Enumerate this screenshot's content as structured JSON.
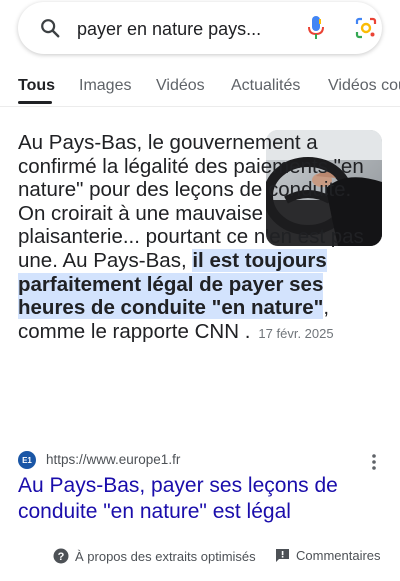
{
  "search": {
    "query": "payer en nature pays..."
  },
  "tabs": [
    {
      "label": "Tous",
      "active": true
    },
    {
      "label": "Images"
    },
    {
      "label": "Vidéos"
    },
    {
      "label": "Actualités"
    },
    {
      "label": "Vidéos cou"
    }
  ],
  "snippet": {
    "text_before": "Au Pays-Bas, le gouvernement a confirmé la légalité des paiements \"en nature\" pour des leçons de conduite. On croirait à une mauvaise plaisanterie... pourtant ce n'en est pas une. Au Pays-Bas, ",
    "highlight": "il est toujours parfaitement légal de payer ses heures de conduite \"en nature\"",
    "text_after": ", comme le rapporte CNN .",
    "date": "17 févr. 2025"
  },
  "source": {
    "favicon_text": "E1",
    "url": "https://www.europe1.fr",
    "title": "Au Pays-Bas, payer ses leçons de conduite \"en nature\" est légal"
  },
  "footer": {
    "about": "À propos des extraits optimisés",
    "feedback": "Commentaires"
  },
  "colors": {
    "link": "#1a0dab",
    "highlight": "#d3e3fd"
  },
  "icons": [
    "search-icon",
    "mic-icon",
    "lens-icon",
    "more-vert-icon",
    "help-icon",
    "feedback-icon"
  ]
}
